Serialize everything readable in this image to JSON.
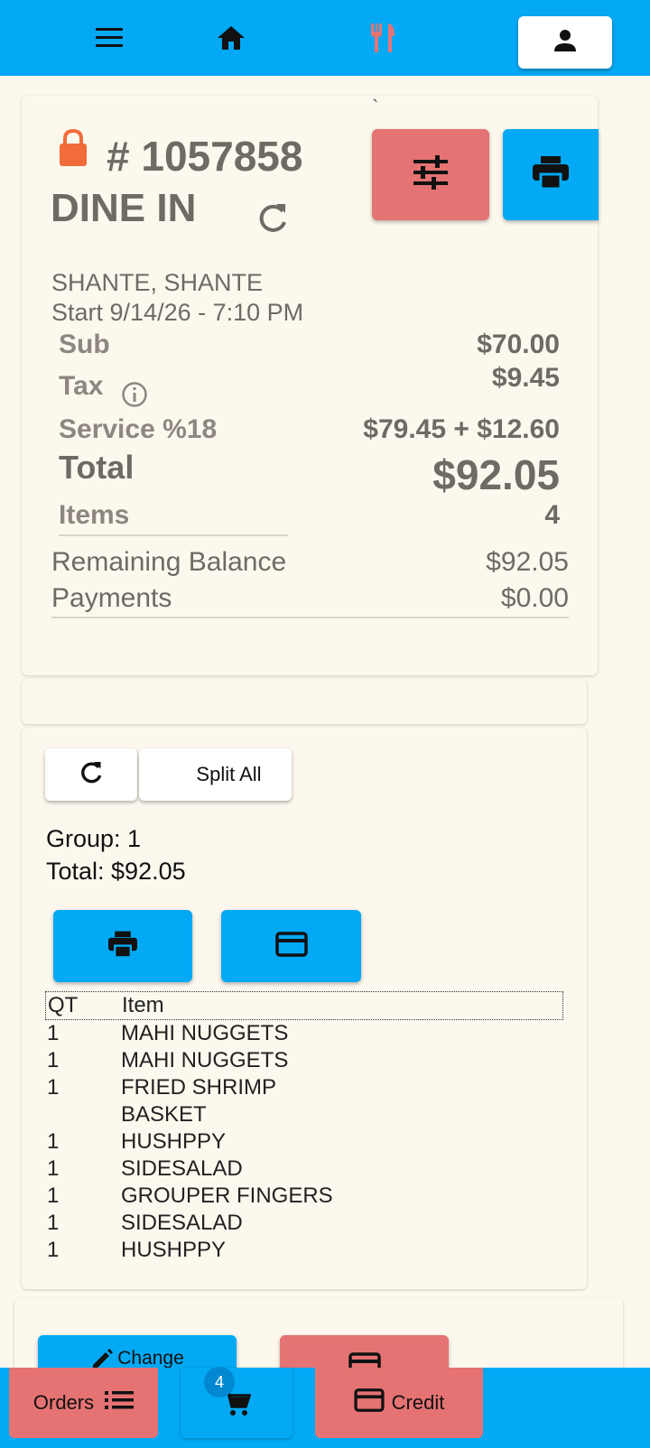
{
  "order": {
    "backtick": "`",
    "number": "# 1057858",
    "type": "DINE IN",
    "customer": "SHANTE, SHANTE",
    "start": "Start 9/14/26 - 7:10 PM"
  },
  "totals": {
    "sub_label": "Sub",
    "sub_value": "$70.00",
    "tax_label": "Tax",
    "tax_value": "$9.45",
    "service_label": "Service %18",
    "service_value": "$79.45 + $12.60",
    "total_label": "Total",
    "total_value": "$92.05",
    "items_label": "Items",
    "items_value": "4",
    "remaining_label": "Remaining Balance",
    "remaining_value": "$92.05",
    "payments_label": "Payments",
    "payments_value": "$0.00"
  },
  "split": {
    "split_all_label": "Split All",
    "group": "Group: 1",
    "total": "Total: $92.05"
  },
  "table": {
    "headers": {
      "qt": "QT",
      "item": "Item"
    },
    "rows": [
      {
        "qt": "1",
        "item": "MAHI NUGGETS"
      },
      {
        "qt": "1",
        "item": "MAHI NUGGETS"
      },
      {
        "qt": "1",
        "item": "FRIED SHRIMP"
      },
      {
        "qt": "",
        "item": "BASKET"
      },
      {
        "qt": "1",
        "item": "HUSHPPY"
      },
      {
        "qt": "1",
        "item": "SIDESALAD"
      },
      {
        "qt": "1",
        "item": "GROUPER FINGERS"
      },
      {
        "qt": "1",
        "item": "SIDESALAD"
      },
      {
        "qt": "1",
        "item": "HUSHPPY"
      }
    ]
  },
  "actions": {
    "change_label": "Change"
  },
  "bottom": {
    "orders_label": "Orders",
    "cart_count": "4",
    "credit_label": "Credit"
  },
  "icons": {
    "menu": "menu-icon",
    "home": "home-icon",
    "restaurant": "fork-knife-icon",
    "profile": "person-icon",
    "lock": "lock-icon",
    "settings": "tune-icon",
    "print": "print-icon",
    "refresh": "refresh-icon",
    "info": "info-icon",
    "card": "credit-card-icon",
    "edit": "pencil-icon",
    "cart": "cart-icon",
    "list": "list-icon"
  },
  "colors": {
    "primary": "#03a9f4",
    "danger": "#e57373",
    "lock": "#f26b3a",
    "background": "#fcf8ee"
  }
}
